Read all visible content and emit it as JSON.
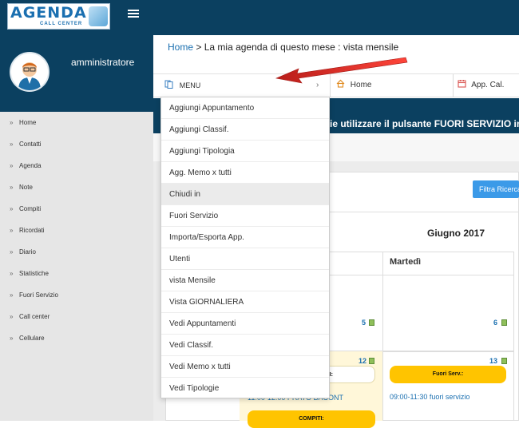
{
  "app": {
    "logo_text": "AGENDA",
    "logo_subtext": "CALL CENTER"
  },
  "user": {
    "name": "amministratore"
  },
  "sidebar": {
    "items": [
      {
        "label": "Home"
      },
      {
        "label": "Contatti"
      },
      {
        "label": "Agenda"
      },
      {
        "label": "Note"
      },
      {
        "label": "Compiti"
      },
      {
        "label": "Ricordati"
      },
      {
        "label": "Diario"
      },
      {
        "label": "Statistiche"
      },
      {
        "label": "Fuori Servizio"
      },
      {
        "label": "Call center"
      },
      {
        "label": "Cellulare"
      }
    ]
  },
  "breadcrumb": {
    "home": "Home",
    "separator": ">",
    "current": "La mia agenda di questo mese : vista mensile"
  },
  "nav": {
    "menu_label": "MENU",
    "menu_chevron": "›",
    "home_label": "Home",
    "appcal_label": "App. Cal."
  },
  "banner": {
    "text": "ie utilizzare il pulsante FUORI SERVIZIO in"
  },
  "filter_button": {
    "label": "Filtra Ricerca"
  },
  "calendar": {
    "month_label": "Giugno 2017",
    "day_name": "Martedì",
    "numbers": [
      "5",
      "6",
      "12",
      "13"
    ]
  },
  "events": {
    "fuori_serv_label": "Fuori Serv.:",
    "fuori_serv_time": "09:00-11:30 fuori servizio",
    "cell12_pill": "I:",
    "cell12_line": "11:00-12:00 PRATO BACONT",
    "compiti_label": "COMPITI:"
  },
  "dropdown": {
    "items": [
      {
        "label": "Aggiungi Appuntamento"
      },
      {
        "label": "Aggiungi Classif."
      },
      {
        "label": "Aggiungi Tipologia"
      },
      {
        "label": "Agg. Memo x tutti"
      },
      {
        "label": "Chiudi in"
      },
      {
        "label": "Fuori Servizio"
      },
      {
        "label": "Importa/Esporta App."
      },
      {
        "label": "Utenti"
      },
      {
        "label": "vista Mensile"
      },
      {
        "label": "Vista GIORNALIERA"
      },
      {
        "label": "Vedi Appuntamenti"
      },
      {
        "label": "Vedi Classif."
      },
      {
        "label": "Vedi Memo x tutti"
      },
      {
        "label": "Vedi Tipologie"
      }
    ],
    "active_index": 4
  },
  "icons": {
    "menu": "book-icon",
    "home": "home-icon",
    "appcal": "calendar-icon",
    "sidebar_item": "double-chevron-right-icon",
    "annotation": "red-arrow-icon"
  },
  "colors": {
    "header_bg": "#0b4060",
    "sidebar_bg": "#e6e6e6",
    "link": "#1a6fb0",
    "accent_button": "#3b9ae8",
    "pill_yellow": "#ffc400",
    "arrow": "#e0201b"
  }
}
